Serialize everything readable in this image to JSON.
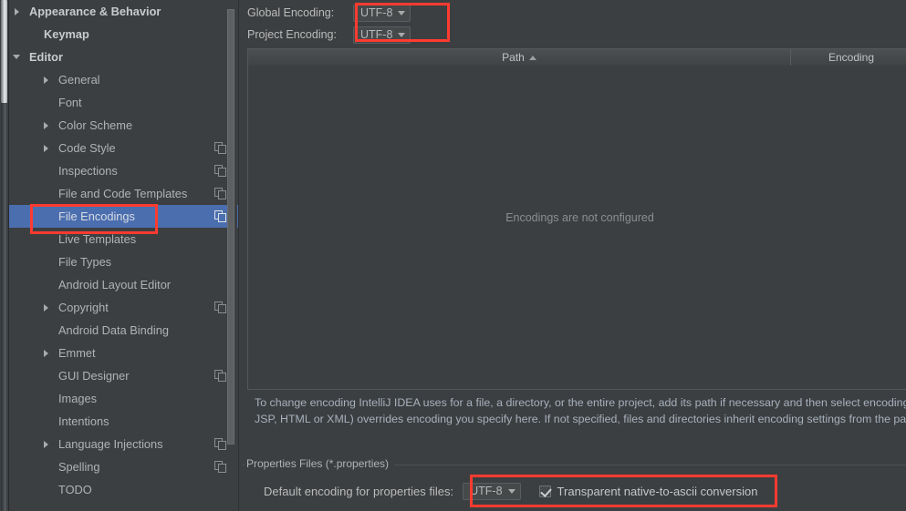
{
  "sidebar": {
    "items": [
      {
        "label": "Appearance & Behavior",
        "indent": 22,
        "arrow": "right",
        "bold": true,
        "copy": false,
        "selected": false
      },
      {
        "label": "Keymap",
        "indent": 38,
        "arrow": "none",
        "bold": true,
        "copy": false,
        "selected": false
      },
      {
        "label": "Editor",
        "indent": 22,
        "arrow": "down",
        "bold": true,
        "copy": false,
        "selected": false
      },
      {
        "label": "General",
        "indent": 54,
        "arrow": "right",
        "bold": false,
        "copy": false,
        "selected": false
      },
      {
        "label": "Font",
        "indent": 54,
        "arrow": "none",
        "bold": false,
        "copy": false,
        "selected": false
      },
      {
        "label": "Color Scheme",
        "indent": 54,
        "arrow": "right",
        "bold": false,
        "copy": false,
        "selected": false
      },
      {
        "label": "Code Style",
        "indent": 54,
        "arrow": "right",
        "bold": false,
        "copy": true,
        "selected": false
      },
      {
        "label": "Inspections",
        "indent": 54,
        "arrow": "none",
        "bold": false,
        "copy": true,
        "selected": false
      },
      {
        "label": "File and Code Templates",
        "indent": 54,
        "arrow": "none",
        "bold": false,
        "copy": true,
        "selected": false
      },
      {
        "label": "File Encodings",
        "indent": 54,
        "arrow": "none",
        "bold": false,
        "copy": true,
        "selected": true
      },
      {
        "label": "Live Templates",
        "indent": 54,
        "arrow": "none",
        "bold": false,
        "copy": false,
        "selected": false
      },
      {
        "label": "File Types",
        "indent": 54,
        "arrow": "none",
        "bold": false,
        "copy": false,
        "selected": false
      },
      {
        "label": "Android Layout Editor",
        "indent": 54,
        "arrow": "none",
        "bold": false,
        "copy": false,
        "selected": false
      },
      {
        "label": "Copyright",
        "indent": 54,
        "arrow": "right",
        "bold": false,
        "copy": true,
        "selected": false
      },
      {
        "label": "Android Data Binding",
        "indent": 54,
        "arrow": "none",
        "bold": false,
        "copy": false,
        "selected": false
      },
      {
        "label": "Emmet",
        "indent": 54,
        "arrow": "right",
        "bold": false,
        "copy": false,
        "selected": false
      },
      {
        "label": "GUI Designer",
        "indent": 54,
        "arrow": "none",
        "bold": false,
        "copy": true,
        "selected": false
      },
      {
        "label": "Images",
        "indent": 54,
        "arrow": "none",
        "bold": false,
        "copy": false,
        "selected": false
      },
      {
        "label": "Intentions",
        "indent": 54,
        "arrow": "none",
        "bold": false,
        "copy": false,
        "selected": false
      },
      {
        "label": "Language Injections",
        "indent": 54,
        "arrow": "right",
        "bold": false,
        "copy": true,
        "selected": false
      },
      {
        "label": "Spelling",
        "indent": 54,
        "arrow": "none",
        "bold": false,
        "copy": true,
        "selected": false
      },
      {
        "label": "TODO",
        "indent": 54,
        "arrow": "none",
        "bold": false,
        "copy": false,
        "selected": false
      }
    ]
  },
  "main": {
    "global_encoding_label": "Global Encoding:",
    "global_encoding_value": "UTF-8",
    "project_encoding_label": "Project Encoding:",
    "project_encoding_value": "UTF-8",
    "table": {
      "columns": [
        "Path",
        "Encoding"
      ],
      "sort_column": "Path",
      "sort_direction": "asc",
      "rows": [],
      "empty_message": "Encodings are not configured"
    },
    "help_text": "To change encoding IntelliJ IDEA uses for a file, a directory, or the entire project, add its path if necessary and then select encoding from the encoding list. Built-in file encoding (e.g. JSP, HTML or XML) overrides encoding you specify here. If not specified, files and directories inherit encoding settings from the parent directory or from the Project Encoding.",
    "properties_group_title": "Properties Files (*.properties)",
    "properties_default_label": "Default encoding for properties files:",
    "properties_default_value": "UTF-8",
    "transparent_conversion_label": "Transparent native-to-ascii conversion",
    "transparent_conversion_checked": "checked"
  },
  "colors": {
    "background": "#3c3f41",
    "selection": "#4b6eaf",
    "annotation": "#ff3b30",
    "text": "#bbbbbb"
  }
}
